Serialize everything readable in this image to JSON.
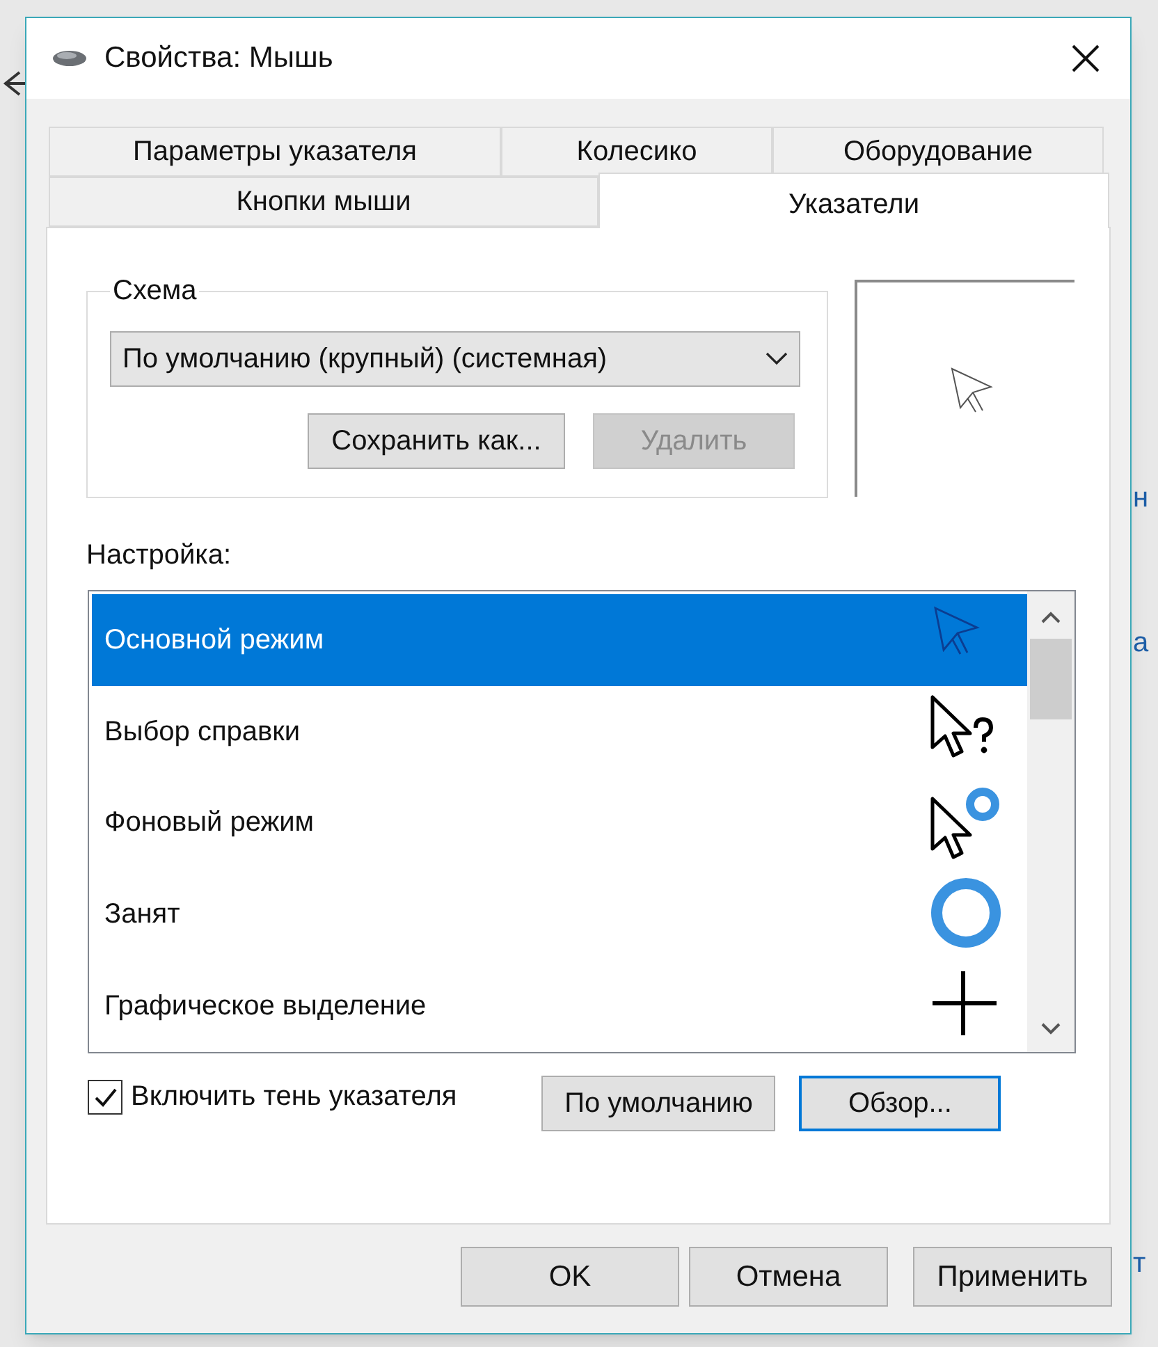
{
  "window": {
    "title": "Свойства: Мышь"
  },
  "tab_rows": [
    [
      {
        "label": "Параметры указателя",
        "selected": false
      },
      {
        "label": "Колесико",
        "selected": false
      },
      {
        "label": "Оборудование",
        "selected": false
      }
    ],
    [
      {
        "label": "Кнопки мыши",
        "selected": false
      },
      {
        "label": "Указатели",
        "selected": true
      }
    ]
  ],
  "scheme": {
    "label": "Схема",
    "value": "По умолчанию (крупный) (системная)",
    "buttons": [
      {
        "label": "Сохранить как...",
        "disabled": false
      },
      {
        "label": "Удалить",
        "disabled": true
      }
    ]
  },
  "customize": {
    "label": "Настройка:",
    "items": [
      {
        "name": "Основной режим",
        "kind": "arrow",
        "selected": true
      },
      {
        "name": "Выбор справки",
        "kind": "help",
        "selected": false
      },
      {
        "name": "Фоновый режим",
        "kind": "working",
        "selected": false
      },
      {
        "name": "Занят",
        "kind": "busy",
        "selected": false
      },
      {
        "name": "Графическое выделение",
        "kind": "cross",
        "selected": false
      }
    ]
  },
  "shadow": {
    "label": "Включить тень указателя",
    "checked": true
  },
  "list_buttons": [
    {
      "label": "По умолчанию",
      "focused": false
    },
    {
      "label": "Обзор...",
      "focused": true
    }
  ],
  "buttons": [
    "OK",
    "Отмена",
    "Применить"
  ],
  "background_fragments": [
    "н",
    "а",
    "т"
  ]
}
